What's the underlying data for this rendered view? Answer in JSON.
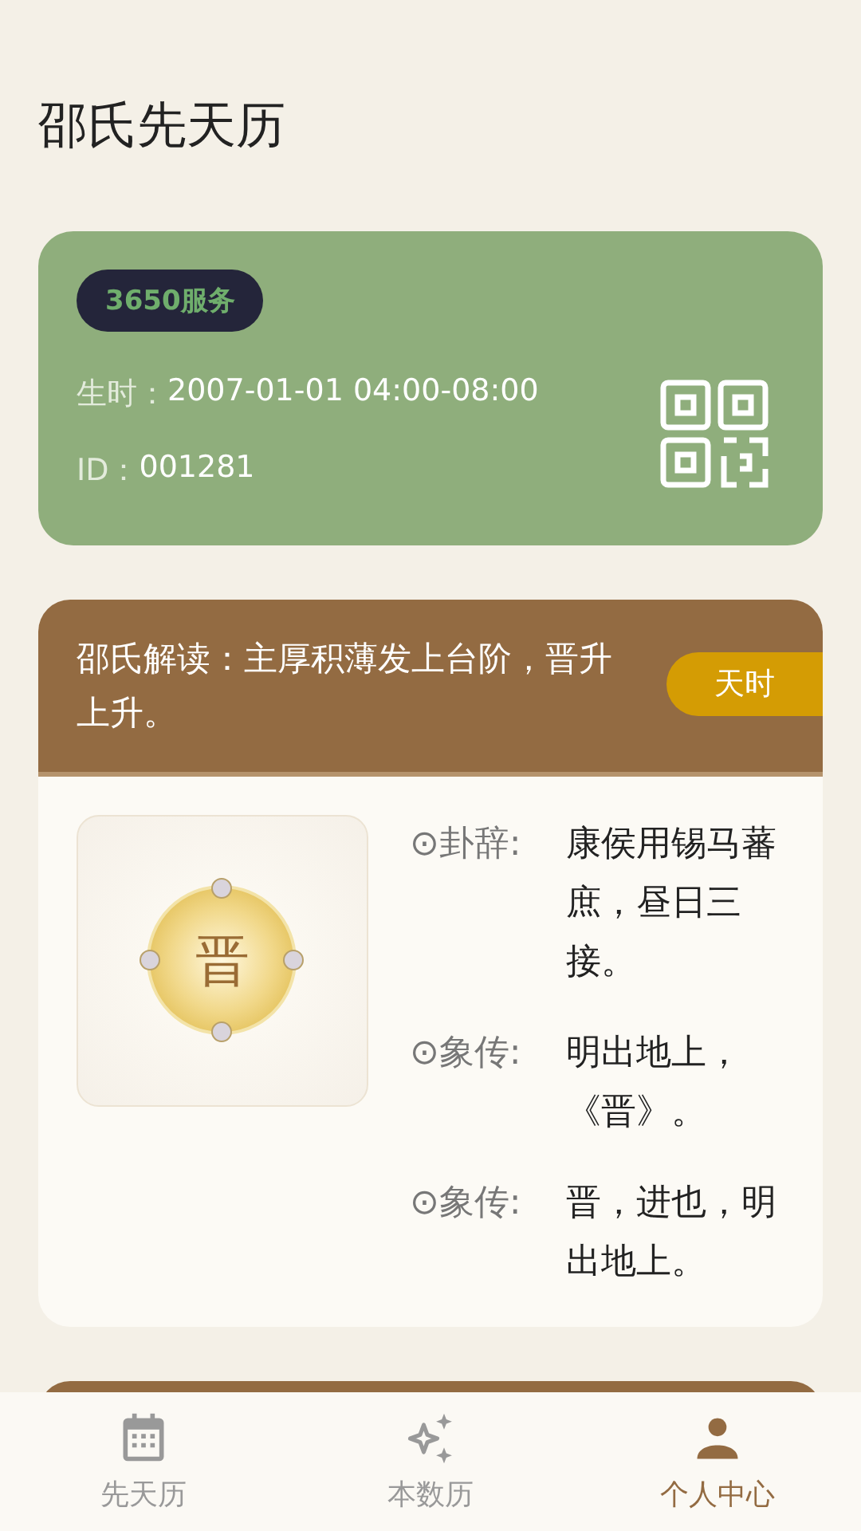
{
  "title": "邵氏先天历",
  "profile_card": {
    "badge": "3650服务",
    "birth_label": "生时：",
    "birth_value": "2007-01-01 04:00-08:00",
    "id_label": "ID：",
    "id_value": "001281"
  },
  "readings": [
    {
      "kind": "full",
      "header": "邵氏解读：主厚积薄发上台阶，晋升上升。",
      "tag": "天时",
      "hexagram": "晋",
      "lines": [
        {
          "label": "⊙卦辞:",
          "text": "康侯用锡马蕃庶，昼日三接。"
        },
        {
          "label": "⊙象传:",
          "text": "明出地上，《晋》。"
        },
        {
          "label": "⊙象传:",
          "text": "晋，进也，明出地上。"
        }
      ]
    },
    {
      "kind": "peek"
    }
  ],
  "tabs": [
    {
      "label": "先天历",
      "kind": "calendar",
      "selected": false
    },
    {
      "label": "本数历",
      "kind": "sparkle",
      "selected": false
    },
    {
      "label": "个人中心",
      "kind": "person",
      "selected": true
    }
  ]
}
